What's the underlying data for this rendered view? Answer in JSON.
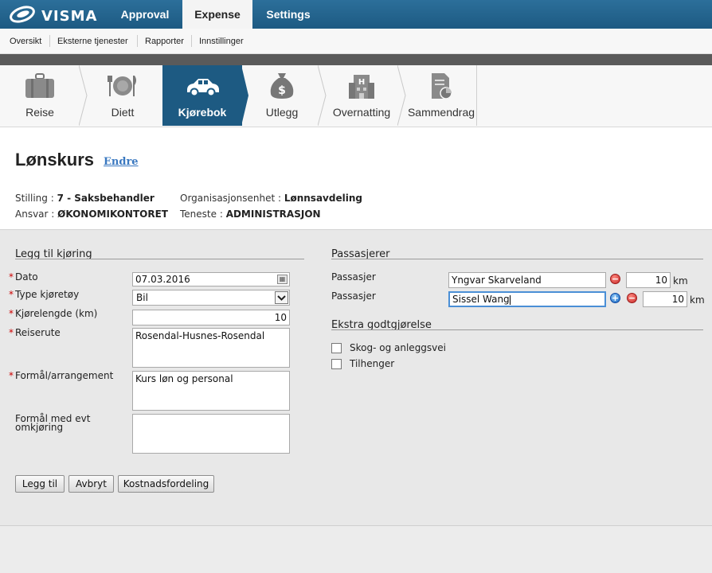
{
  "brand": {
    "logo_text": "VISMA",
    "accent": "#1d5a82"
  },
  "topnav": [
    {
      "label": "Approval",
      "active": false
    },
    {
      "label": "Expense",
      "active": true
    },
    {
      "label": "Settings",
      "active": false
    }
  ],
  "subnav": [
    "Oversikt",
    "Eksterne tjenester",
    "Rapporter",
    "Innstillinger"
  ],
  "tabs": [
    {
      "label": "Reise",
      "icon": "suitcase-icon",
      "active": false
    },
    {
      "label": "Diett",
      "icon": "plate-cutlery-icon",
      "active": false
    },
    {
      "label": "Kjørebok",
      "icon": "car-icon",
      "active": true
    },
    {
      "label": "Utlegg",
      "icon": "money-bag-icon",
      "active": false
    },
    {
      "label": "Overnatting",
      "icon": "hotel-icon",
      "active": false
    },
    {
      "label": "Sammendrag",
      "icon": "document-chart-icon",
      "active": false
    }
  ],
  "header": {
    "title": "Lønskurs",
    "edit_link": "Endre",
    "meta": {
      "stilling_label": "Stilling : ",
      "stilling_value": "7 - Saksbehandler",
      "org_label": "Organisasjonsenhet : ",
      "org_value": "Lønnsavdeling",
      "ansvar_label": "Ansvar : ",
      "ansvar_value": "ØKONOMIKONTORET",
      "teneste_label": "Teneste : ",
      "teneste_value": "ADMINISTRASJON"
    }
  },
  "form": {
    "section_title": "Legg til kjøring",
    "dato_label": "Dato",
    "dato_value": "07.03.2016",
    "type_label": "Type kjøretøy",
    "type_value": "Bil",
    "lengde_label": "Kjørelengde (km)",
    "lengde_value": "10",
    "reiserute_label": "Reiserute",
    "reiserute_value": "Rosendal-Husnes-Rosendal",
    "formal_label": "Formål/arrangement",
    "formal_value": "Kurs løn og personal",
    "omkjoring_label_1": "Formål med evt",
    "omkjoring_label_2": "omkjøring",
    "omkjoring_value": "",
    "buttons": {
      "add": "Legg til",
      "cancel": "Avbryt",
      "cost": "Kostnadsfordeling"
    }
  },
  "passengers": {
    "section_title": "Passasjerer",
    "rows": [
      {
        "label": "Passasjer",
        "name": "Yngvar Skarveland",
        "km": "10",
        "unit": "km"
      },
      {
        "label": "Passasjer",
        "name": "Sissel Wang",
        "km": "10",
        "unit": "km"
      }
    ]
  },
  "extra": {
    "section_title": "Ekstra godtgjørelse",
    "options": [
      {
        "label": "Skog- og anleggsvei",
        "checked": false
      },
      {
        "label": "Tilhenger",
        "checked": false
      }
    ]
  }
}
